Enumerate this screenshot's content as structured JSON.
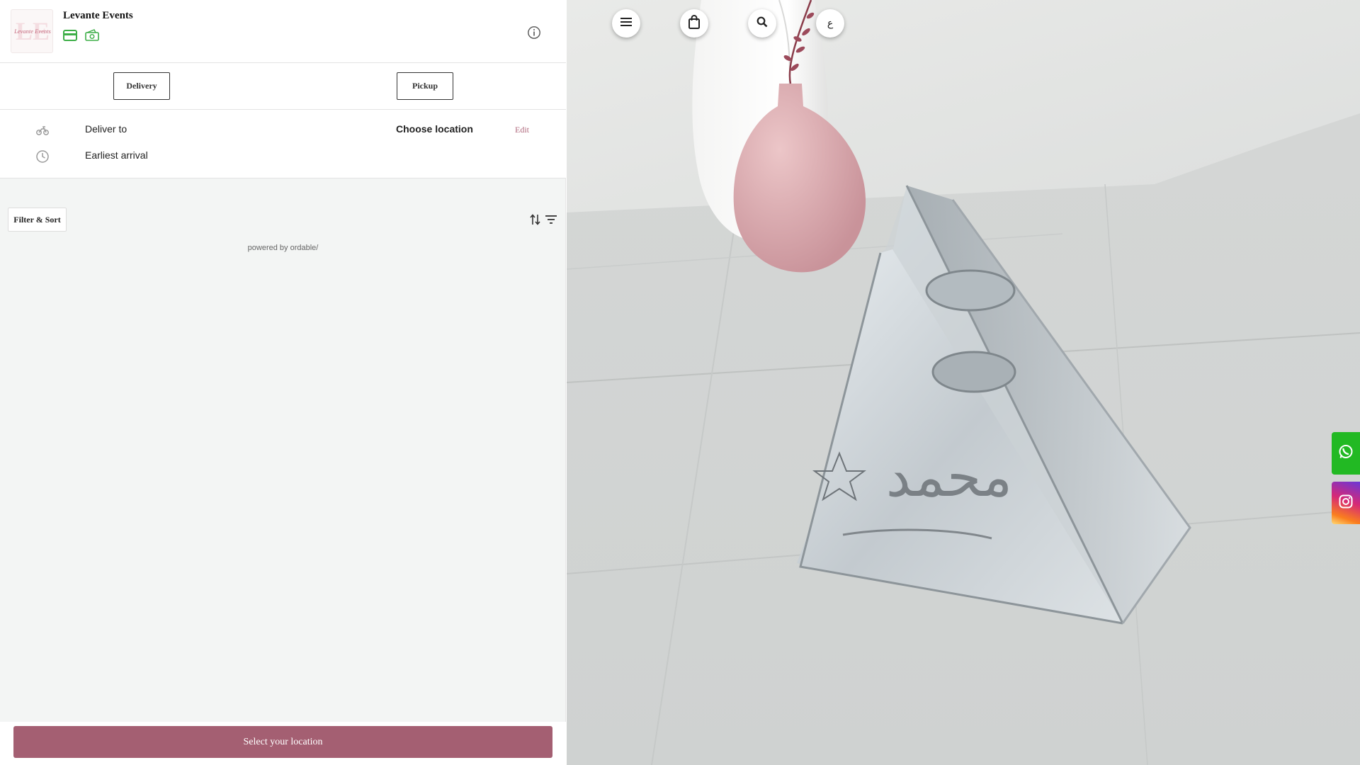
{
  "header": {
    "store_name": "Levante Events",
    "logo_text": "Levante Events",
    "payment_icons": [
      "credit-card-icon",
      "cash-icon"
    ]
  },
  "order_modes": {
    "delivery_label": "Delivery",
    "pickup_label": "Pickup"
  },
  "delivery_info": {
    "deliver_to_label": "Deliver to",
    "location_value": "Choose location",
    "edit_label": "Edit",
    "earliest_arrival_label": "Earliest arrival"
  },
  "listing": {
    "filter_sort_label": "Filter & Sort",
    "powered_by": "powered by ordable/"
  },
  "footer": {
    "cta_label": "Select your location"
  },
  "top_nav": {
    "language_label": "ع"
  },
  "hero": {
    "engraving_text": "محمد"
  },
  "colors": {
    "accent": "#a45f72",
    "edit_link": "#b06a7d",
    "payment_icon": "#3cae46",
    "whatsapp": "#22b923",
    "panel_bg": "#f3f5f4"
  }
}
